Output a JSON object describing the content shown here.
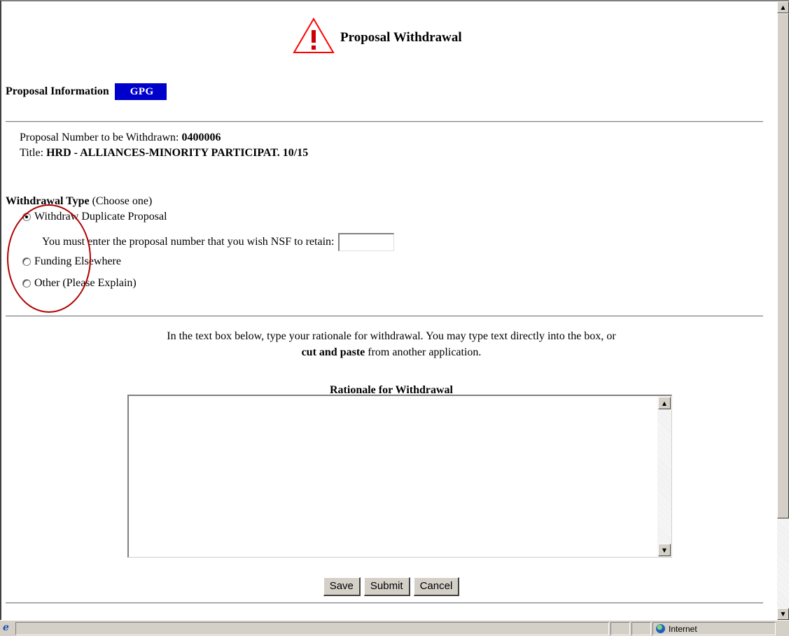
{
  "page": {
    "title": "Proposal Withdrawal",
    "title_icon": "warning-triangle-icon"
  },
  "proposal_info": {
    "label": "Proposal Information",
    "badge": "GPG",
    "badge_color": "#0000cc",
    "number_label": "Proposal Number to be Withdrawn: ",
    "number_value": "0400006",
    "title_label": "Title: ",
    "title_value": "HRD - ALLIANCES-MINORITY PARTICIPAT. 10/15"
  },
  "withdrawal_type": {
    "heading": "Withdrawal Type",
    "hint": " (Choose one)",
    "options": [
      {
        "label": "Withdraw Duplicate Proposal",
        "checked": true
      },
      {
        "label": "Funding Elsewhere",
        "checked": false
      },
      {
        "label": "Other (Please Explain)",
        "checked": false
      }
    ],
    "retain_prompt": "You must enter the proposal number that you wish NSF to retain:",
    "retain_value": "",
    "annotation_color": "#b30000"
  },
  "rationale": {
    "instructions_1": "In the text box below, type your rationale for withdrawal. You may type text directly into the box, or",
    "instructions_bold": "cut and paste",
    "instructions_2": " from another application.",
    "title": "Rationale for Withdrawal",
    "value": ""
  },
  "buttons": {
    "save": "Save",
    "submit": "Submit",
    "cancel": "Cancel"
  },
  "statusbar": {
    "zone": "Internet"
  }
}
